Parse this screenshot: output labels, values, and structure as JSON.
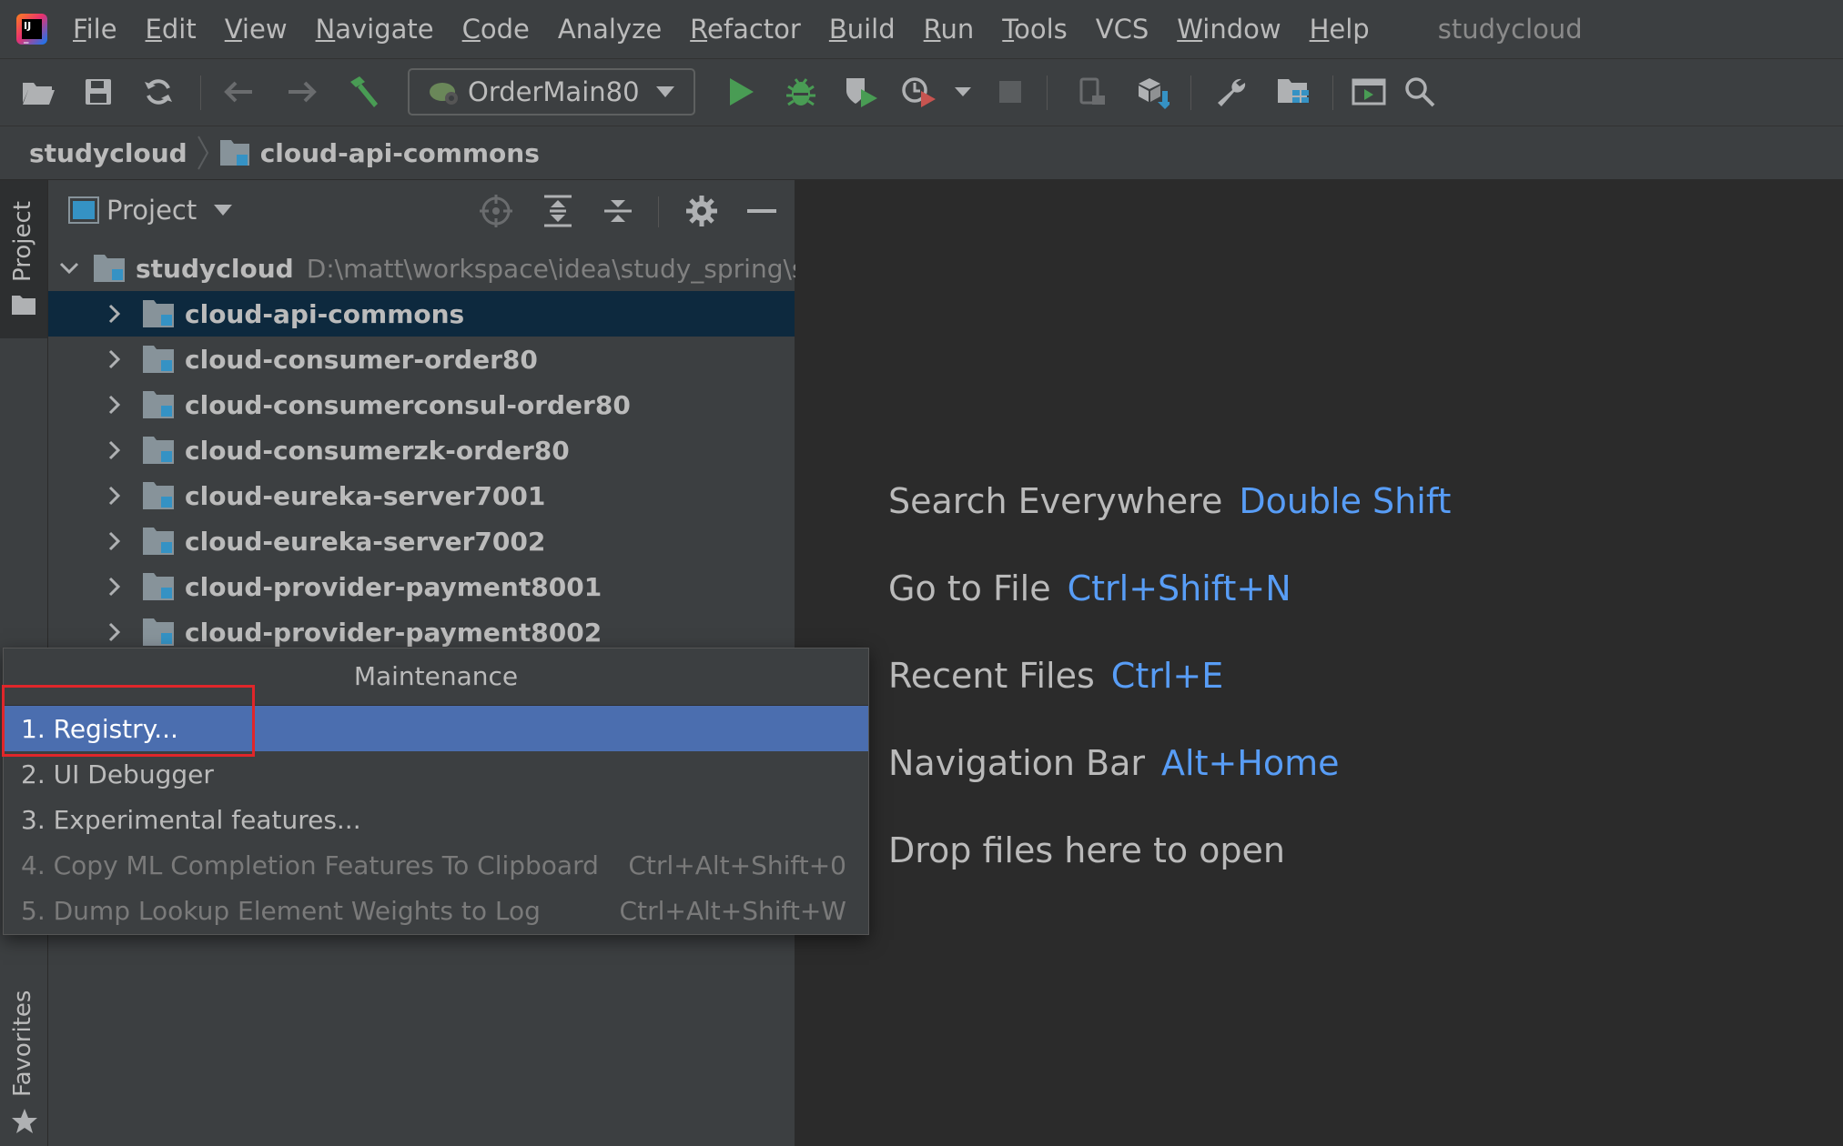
{
  "menubar": {
    "items": [
      {
        "mnemonic": "F",
        "rest": "ile"
      },
      {
        "mnemonic": "E",
        "rest": "dit"
      },
      {
        "mnemonic": "V",
        "rest": "iew"
      },
      {
        "mnemonic": "N",
        "rest": "avigate"
      },
      {
        "mnemonic": "C",
        "rest": "ode"
      },
      {
        "mnemonic": "",
        "rest": "Analyze"
      },
      {
        "mnemonic": "R",
        "rest": "efactor"
      },
      {
        "mnemonic": "B",
        "rest": "uild"
      },
      {
        "mnemonic": "R",
        "rest": "un"
      },
      {
        "mnemonic": "T",
        "rest": "ools"
      },
      {
        "mnemonic": "",
        "rest": "VCS"
      },
      {
        "mnemonic": "W",
        "rest": "indow"
      },
      {
        "mnemonic": "H",
        "rest": "elp"
      }
    ],
    "project_title": "studycloud"
  },
  "toolbar": {
    "run_config": "OrderMain80"
  },
  "breadcrumb": {
    "root": "studycloud",
    "module": "cloud-api-commons"
  },
  "left_strip": {
    "project_label": "Project",
    "favorites_label": "Favorites"
  },
  "project_panel": {
    "title": "Project",
    "root": {
      "name": "studycloud",
      "path": "D:\\matt\\workspace\\idea\\study_spring\\st"
    },
    "modules": [
      {
        "name": "cloud-api-commons",
        "selected": true
      },
      {
        "name": "cloud-consumer-order80",
        "selected": false
      },
      {
        "name": "cloud-consumerconsul-order80",
        "selected": false
      },
      {
        "name": "cloud-consumerzk-order80",
        "selected": false
      },
      {
        "name": "cloud-eureka-server7001",
        "selected": false
      },
      {
        "name": "cloud-eureka-server7002",
        "selected": false
      },
      {
        "name": "cloud-provider-payment8001",
        "selected": false
      },
      {
        "name": "cloud-provider-payment8002",
        "selected": false
      }
    ]
  },
  "editor": {
    "hints": [
      {
        "text": "Search Everywhere",
        "shortcut": "Double Shift"
      },
      {
        "text": "Go to File",
        "shortcut": "Ctrl+Shift+N"
      },
      {
        "text": "Recent Files",
        "shortcut": "Ctrl+E"
      },
      {
        "text": "Navigation Bar",
        "shortcut": "Alt+Home"
      },
      {
        "text": "Drop files here to open",
        "shortcut": ""
      }
    ]
  },
  "popup": {
    "title": "Maintenance",
    "items": [
      {
        "label": "1. Registry...",
        "shortcut": "",
        "state": "selected"
      },
      {
        "label": "2. UI Debugger",
        "shortcut": "",
        "state": "enabled"
      },
      {
        "label": "3. Experimental features...",
        "shortcut": "",
        "state": "enabled"
      },
      {
        "label": "4. Copy ML Completion Features To Clipboard",
        "shortcut": "Ctrl+Alt+Shift+0",
        "state": "disabled"
      },
      {
        "label": "5. Dump Lookup Element Weights to Log",
        "shortcut": "Ctrl+Alt+Shift+W",
        "state": "disabled"
      }
    ]
  },
  "colors": {
    "accent_link": "#589df6",
    "selection": "#4b6eaf",
    "tree_selection": "#0d293e",
    "highlight_box": "#e0262a"
  }
}
